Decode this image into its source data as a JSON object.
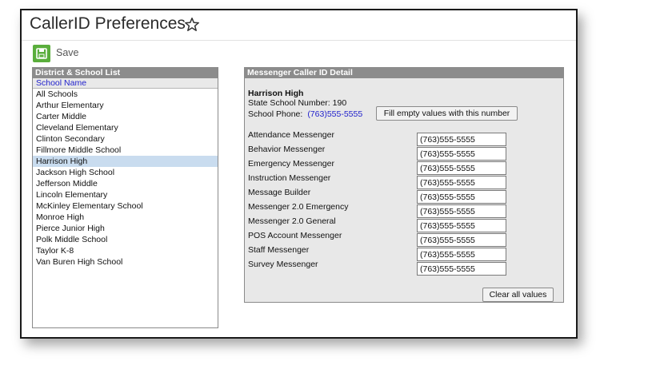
{
  "page": {
    "title": "CallerID Preferences",
    "star_icon": "star-outline-icon"
  },
  "toolbar": {
    "save_label": "Save",
    "save_icon": "floppy-disk-icon",
    "save_color": "#5aae3c"
  },
  "list_panel": {
    "header": "District & School List",
    "column_header": "School Name",
    "items": [
      "All Schools",
      "Arthur Elementary",
      "Carter Middle",
      "Cleveland Elementary",
      "Clinton Secondary",
      "Fillmore Middle School",
      "Harrison High",
      "Jackson High School",
      "Jefferson Middle",
      "Lincoln Elementary",
      "McKinley Elementary School",
      "Monroe High",
      "Pierce Junior High",
      "Polk Middle School",
      "Taylor K-8",
      "Van Buren High School"
    ],
    "selected": "Harrison High"
  },
  "detail": {
    "header": "Messenger Caller ID Detail",
    "school_name": "Harrison High",
    "state_number_label": "State School Number:",
    "state_number": "190",
    "phone_label": "School  Phone:",
    "phone_value": "(763)555-5555",
    "fill_button": "Fill empty values with this number",
    "clear_button": "Clear all values",
    "messengers": [
      {
        "label": "Attendance Messenger",
        "value": "(763)555-5555"
      },
      {
        "label": "Behavior Messenger",
        "value": "(763)555-5555"
      },
      {
        "label": "Emergency Messenger",
        "value": "(763)555-5555"
      },
      {
        "label": "Instruction Messenger",
        "value": "(763)555-5555"
      },
      {
        "label": "Message Builder",
        "value": "(763)555-5555"
      },
      {
        "label": "Messenger 2.0 Emergency",
        "value": "(763)555-5555"
      },
      {
        "label": "Messenger 2.0 General",
        "value": "(763)555-5555"
      },
      {
        "label": "POS Account Messenger",
        "value": "(763)555-5555"
      },
      {
        "label": "Staff Messenger",
        "value": "(763)555-5555"
      },
      {
        "label": "Survey Messenger",
        "value": "(763)555-5555"
      }
    ]
  }
}
